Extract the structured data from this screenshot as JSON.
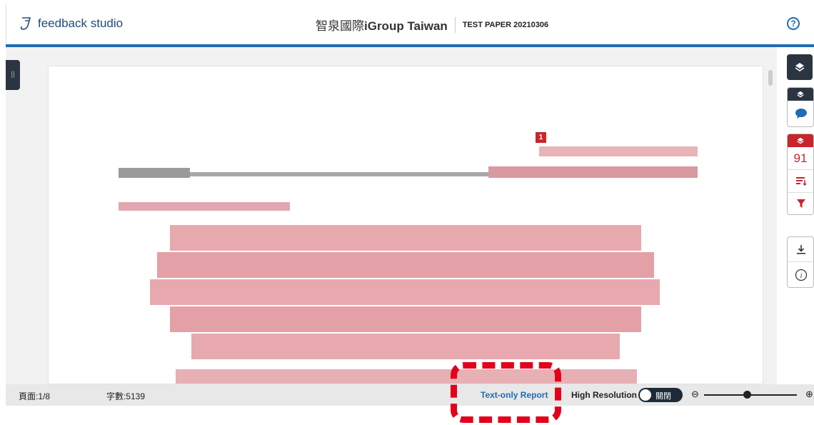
{
  "header": {
    "app_name": "feedback studio",
    "class_name_prefix": "智泉國際",
    "class_name_bold": "iGroup Taiwan",
    "paper_title": "TEST PAPER 20210306",
    "help_symbol": "?"
  },
  "toolbar": {
    "similarity_score": "91",
    "match_marker": "1"
  },
  "status_bar": {
    "page_label": "頁面:1/8",
    "word_count_label": "字數:5139",
    "text_only_report": "Text-only Report",
    "high_resolution_label": "High Resolution",
    "toggle_state_label": "關閉"
  },
  "colors": {
    "brand_blue": "#1e6cb6",
    "dark_panel": "#2b3542",
    "match_red": "#c9252c",
    "annotation_red": "#e2001a"
  },
  "icons": [
    "feedback-studio-logo-icon",
    "help-icon",
    "layers-icon",
    "comment-icon",
    "sort-icon",
    "filter-icon",
    "download-icon",
    "info-icon",
    "zoom-out-icon",
    "zoom-in-icon"
  ]
}
